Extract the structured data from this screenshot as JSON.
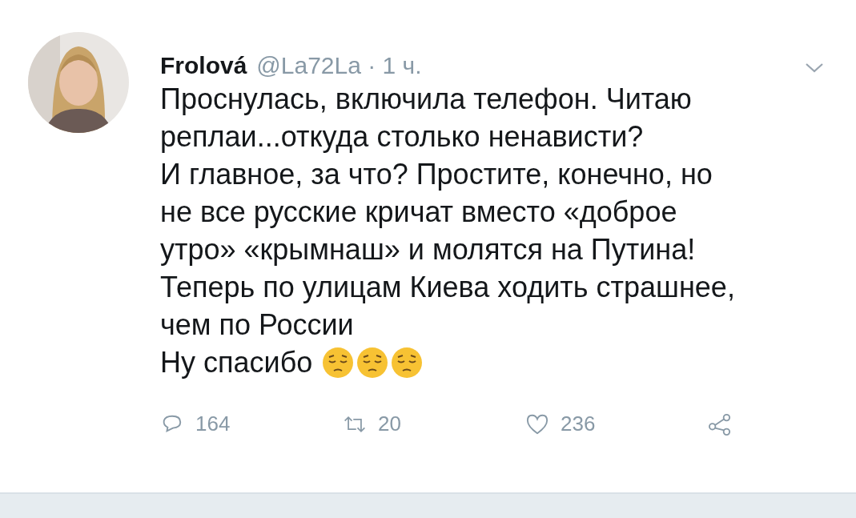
{
  "tweet": {
    "author": "Frolová",
    "handle": "@La72La · 1 ч.",
    "text": "Проснулась, включила телефон. Читаю\nреплаи...откуда столько ненависти?\nИ главное, за что? Простите, конечно, но\nне все русские кричат вместо «доброе\nутро» «крымнаш» и молятся на Путина!\nТеперь по улицам Киева ходить страшнее,\nчем по России",
    "last_line": "Ну спасибо",
    "emojis": [
      {
        "kind": "pensive"
      },
      {
        "kind": "pensive"
      },
      {
        "kind": "pensive"
      }
    ],
    "actions": [
      {
        "kind": "reply",
        "count": "164"
      },
      {
        "kind": "retweet",
        "count": "20"
      },
      {
        "kind": "like",
        "count": "236"
      },
      {
        "kind": "share"
      }
    ]
  }
}
